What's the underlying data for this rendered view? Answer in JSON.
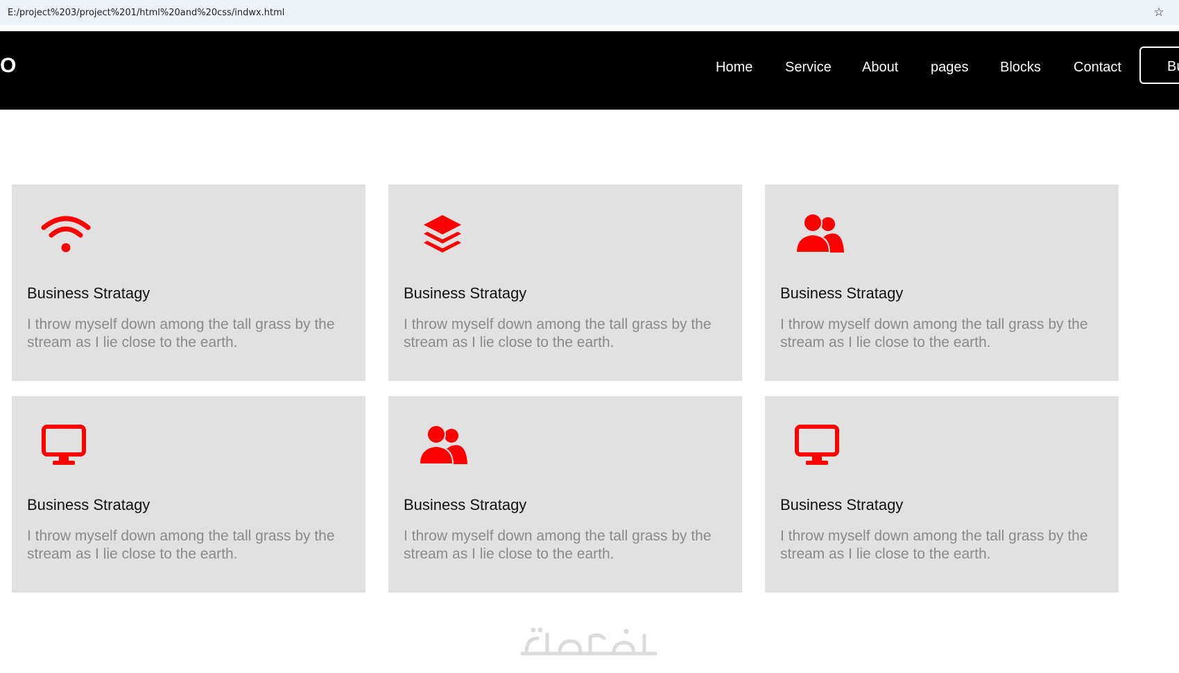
{
  "browser": {
    "url": "E:/project%203/project%201/html%20and%20css/indwx.html"
  },
  "header": {
    "logo": "O",
    "nav": [
      "Home",
      "Service",
      "About",
      "pages",
      "Blocks",
      "Contact"
    ],
    "button_label": "Buy"
  },
  "cards": [
    {
      "icon": "wifi-icon",
      "title": "Business Stratagy",
      "text": "I throw myself down among the tall grass by the stream as I lie close to the earth."
    },
    {
      "icon": "layers-icon",
      "title": "Business Stratagy",
      "text": "I throw myself down among the tall grass by the stream as I lie close to the earth."
    },
    {
      "icon": "users-icon",
      "title": "Business Stratagy",
      "text": "I throw myself down among the tall grass by the stream as I lie close to the earth."
    },
    {
      "icon": "desktop-icon",
      "title": "Business Stratagy",
      "text": "I throw myself down among the tall grass by the stream as I lie close to the earth."
    },
    {
      "icon": "users-icon",
      "title": "Business Stratagy",
      "text": "I throw myself down among the tall grass by the stream as I lie close to the earth."
    },
    {
      "icon": "desktop-icon",
      "title": "Business Stratagy",
      "text": "I throw myself down among the tall grass by the stream as I lie close to the earth."
    }
  ],
  "colors": {
    "accent": "#ff0000",
    "header_bg": "#000000",
    "card_bg": "#e1e1e1",
    "desc_text": "#8a8a8a"
  },
  "watermark": {
    "text": "خمسات"
  }
}
